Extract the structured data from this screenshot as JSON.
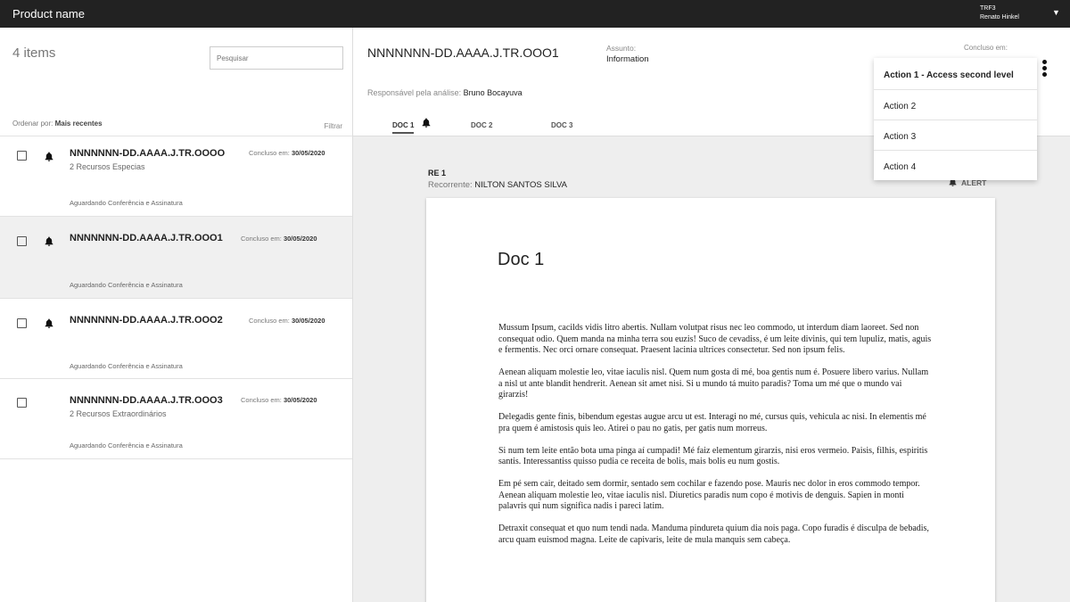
{
  "topbar": {
    "product_name": "Product name",
    "org": "TRF3",
    "user": "Renato Hinkel"
  },
  "list": {
    "count_label": "4 items",
    "search_placeholder": "Pesquisar",
    "sort_label": "Ordenar por:",
    "sort_value": "Mais recentes",
    "filter_label": "Filtrar",
    "date_label": "Concluso em:",
    "items": [
      {
        "code": "NNNNNNN-DD.AAAA.J.TR.OOOO",
        "sub": "2 Recursos Especias",
        "status": "Aguardando Conferência e Assinatura",
        "date": "30/05/2020"
      },
      {
        "code": "NNNNNNN-DD.AAAA.J.TR.OOO1",
        "sub": "",
        "status": "Aguardando Conferência e Assinatura",
        "date": "30/05/2020"
      },
      {
        "code": "NNNNNNN-DD.AAAA.J.TR.OOO2",
        "sub": "",
        "status": "Aguardando Conferência e Assinatura",
        "date": "30/05/2020"
      },
      {
        "code": "NNNNNNN-DD.AAAA.J.TR.OOO3",
        "sub": "2 Recursos Extraordinários",
        "status": "Aguardando Conferência e Assinatura",
        "date": "30/05/2020"
      }
    ]
  },
  "detail": {
    "code": "NNNNNNN-DD.AAAA.J.TR.OOO1",
    "assunto_label": "Assunto:",
    "assunto_value": "Information",
    "concluso_label": "Concluso em:",
    "resp_label": "Responsável pela análise:",
    "resp_value": "Bruno Bocayuva",
    "tabs": [
      "DOC 1",
      "DOC 2",
      "DOC 3"
    ],
    "re_label": "RE 1",
    "recorrente_label": "Recorrente:",
    "recorrente_value": "NILTON SANTOS SILVA",
    "alert_label": "ALERT",
    "doc_title": "Doc 1",
    "paragraphs": [
      "Mussum Ipsum, cacilds vidis litro abertis. Nullam volutpat risus nec leo commodo, ut interdum diam laoreet. Sed non consequat odio. Quem manda na minha terra sou euzis! Suco de cevadiss, é um leite divinis, qui tem lupuliz, matis, aguis e fermentis. Nec orci ornare consequat. Praesent lacinia ultrices consectetur. Sed non ipsum felis.",
      "Aenean aliquam molestie leo, vitae iaculis nisl. Quem num gosta di mé, boa gentis num é. Posuere libero varius. Nullam a nisl ut ante blandit hendrerit. Aenean sit amet nisi. Si u mundo tá muito paradis? Toma um mé que o mundo vai girarzis!",
      "Delegadis gente finis, bibendum egestas augue arcu ut est. Interagi no mé, cursus quis, vehicula ac nisi. In elementis mé pra quem é amistosis quis leo. Atirei o pau no gatis, per gatis num morreus.",
      "Si num tem leite então bota uma pinga aí cumpadi! Mé faiz elementum girarzis, nisi eros vermeio. Paisis, filhis, espiritis santis.  Interessantiss quisso pudia ce receita de bolis, mais bolis eu num gostis.",
      "Em pé sem cair, deitado sem dormir, sentado sem cochilar e fazendo pose. Mauris nec dolor in eros commodo tempor. Aenean aliquam molestie leo, vitae iaculis nisl. Diuretics paradis num copo é motivis de denguis. Sapien in monti palavris qui num significa nadis i pareci latim.",
      "Detraxit consequat et quo num tendi nada. Manduma pindureta quium dia nois paga. Copo furadis é disculpa de bebadis, arcu quam euismod magna. Leite de capivaris, leite de mula manquis sem cabeça."
    ]
  },
  "menu": {
    "items": [
      "Action 1 - Access second level",
      "Action 2",
      "Action 3",
      "Action 4"
    ]
  },
  "colors": {
    "topbar": "#222222",
    "selected_row": "#f0f0f0",
    "canvas": "#eeeeee"
  }
}
